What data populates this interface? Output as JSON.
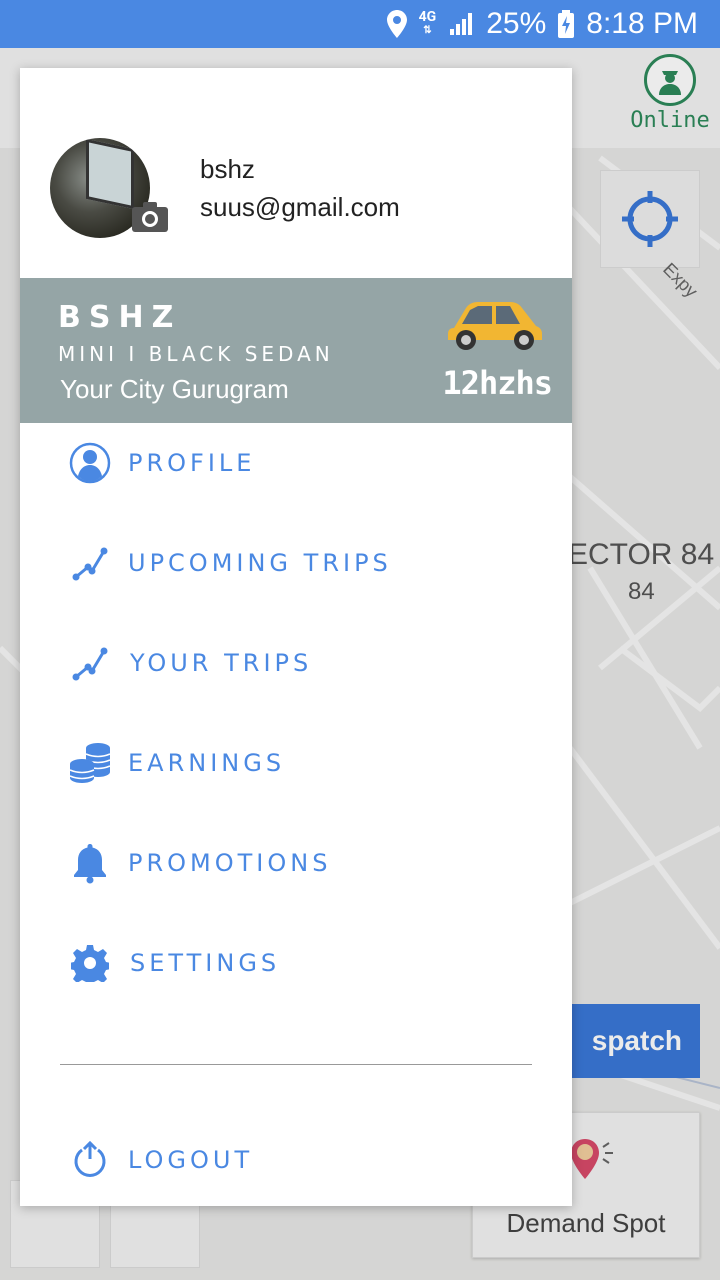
{
  "status_bar": {
    "network": "4G",
    "battery": "25%",
    "time": "8:18 PM"
  },
  "map": {
    "online_label": "Online",
    "sector_label": "ECTOR 84",
    "sector_number": "84",
    "road_label": "Expy",
    "dispatch_label": "spatch",
    "demand_spot_label": "Demand Spot"
  },
  "drawer": {
    "user_name": "bshz",
    "user_email": "suus@gmail.com",
    "driver_name": "BSHZ",
    "vehicle_type": "MINI I BLACK SEDAN",
    "city": "Your City Gurugram",
    "plate_number": "12hzhs",
    "menu": [
      {
        "label": "PROFILE",
        "icon": "profile-icon"
      },
      {
        "label": "UPCOMING TRIPS",
        "icon": "route-icon"
      },
      {
        "label": "YOUR TRIPS",
        "icon": "route-icon"
      },
      {
        "label": "EARNINGS",
        "icon": "coins-icon"
      },
      {
        "label": "PROMOTIONS",
        "icon": "bell-icon"
      },
      {
        "label": "SETTINGS",
        "icon": "gear-icon"
      }
    ],
    "logout_label": "LOGOUT"
  },
  "colors": {
    "accent": "#4a88e2",
    "vehicle_panel": "#95a5a6",
    "online_green": "#2e8a5c"
  }
}
